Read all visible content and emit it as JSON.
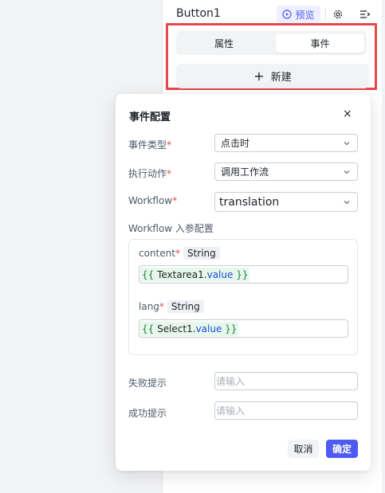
{
  "panel": {
    "component_name": "Button1",
    "preview_label": "预览",
    "tabs": [
      "属性",
      "事件"
    ],
    "active_tab": "事件",
    "new_button_label": "新建"
  },
  "dialog": {
    "title": "事件配置",
    "close_glyph": "×",
    "fields": {
      "event_type": {
        "label": "事件类型",
        "value": "点击时"
      },
      "action": {
        "label": "执行动作",
        "value": "调用工作流"
      },
      "workflow": {
        "label": "Workflow",
        "value": "translation"
      }
    },
    "required_mark": "*",
    "params_title": "Workflow 入参配置",
    "params": [
      {
        "name": "content",
        "type": "String",
        "open": "{{ ",
        "ident": "Textarea1",
        "dot": ".",
        "prop": "value",
        "close": " }}"
      },
      {
        "name": "lang",
        "type": "String",
        "open": "{{ ",
        "ident": "Select1",
        "dot": ".",
        "prop": "value",
        "close": " }}"
      }
    ],
    "fail_tip": {
      "label": "失败提示",
      "placeholder": "请输入"
    },
    "success_tip": {
      "label": "成功提示",
      "placeholder": "请输入"
    },
    "cancel_label": "取消",
    "confirm_label": "确定"
  },
  "colors": {
    "accent": "#4e5bf2",
    "required": "#e5484d",
    "highlight_border": "#e5484d",
    "code_bg": "#e8f7ec"
  },
  "icons": [
    "play-circle-icon",
    "gear-icon",
    "collapse-panel-icon",
    "plus-icon",
    "close-icon",
    "chevron-down-icon"
  ]
}
